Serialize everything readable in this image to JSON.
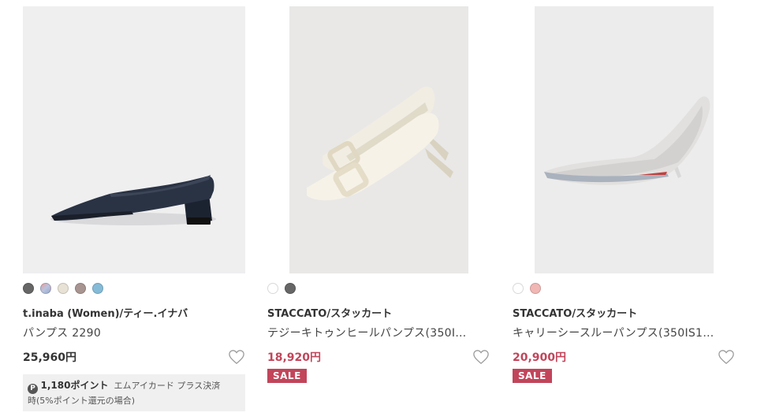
{
  "products": [
    {
      "image_alt": "navy pumps",
      "swatches": [
        "#666666",
        "#b8b8d8",
        "#e8e2d6",
        "#a89490",
        "#86bbd8"
      ],
      "brand": "t.inaba (Women)/ティー.イナバ",
      "name": "パンプス 2290",
      "price": "25,960円",
      "points": {
        "icon": "P",
        "value": "1,180ポイント",
        "note_1": "エムアイカード プラス決済",
        "note_2": "時(5%ポイント還元の場合)"
      }
    },
    {
      "image_alt": "ivory buckle pumps",
      "swatches": [
        "#ffffff",
        "#666666"
      ],
      "brand": "STACCATO/スタッカート",
      "name": "テジーキトゥンヒールパンプス(350I…",
      "price": "18,920円",
      "sale": "SALE"
    },
    {
      "image_alt": "silver see-through pumps",
      "swatches": [
        "#ffffff",
        "#f0b7b4"
      ],
      "brand": "STACCATO/スタッカート",
      "name": "キャリーシースルーパンプス(350IS1…",
      "price": "20,900円",
      "sale": "SALE"
    }
  ],
  "colors": {
    "sale": "#c2455a"
  },
  "icons": {
    "favorite": "heart-outline-icon"
  }
}
